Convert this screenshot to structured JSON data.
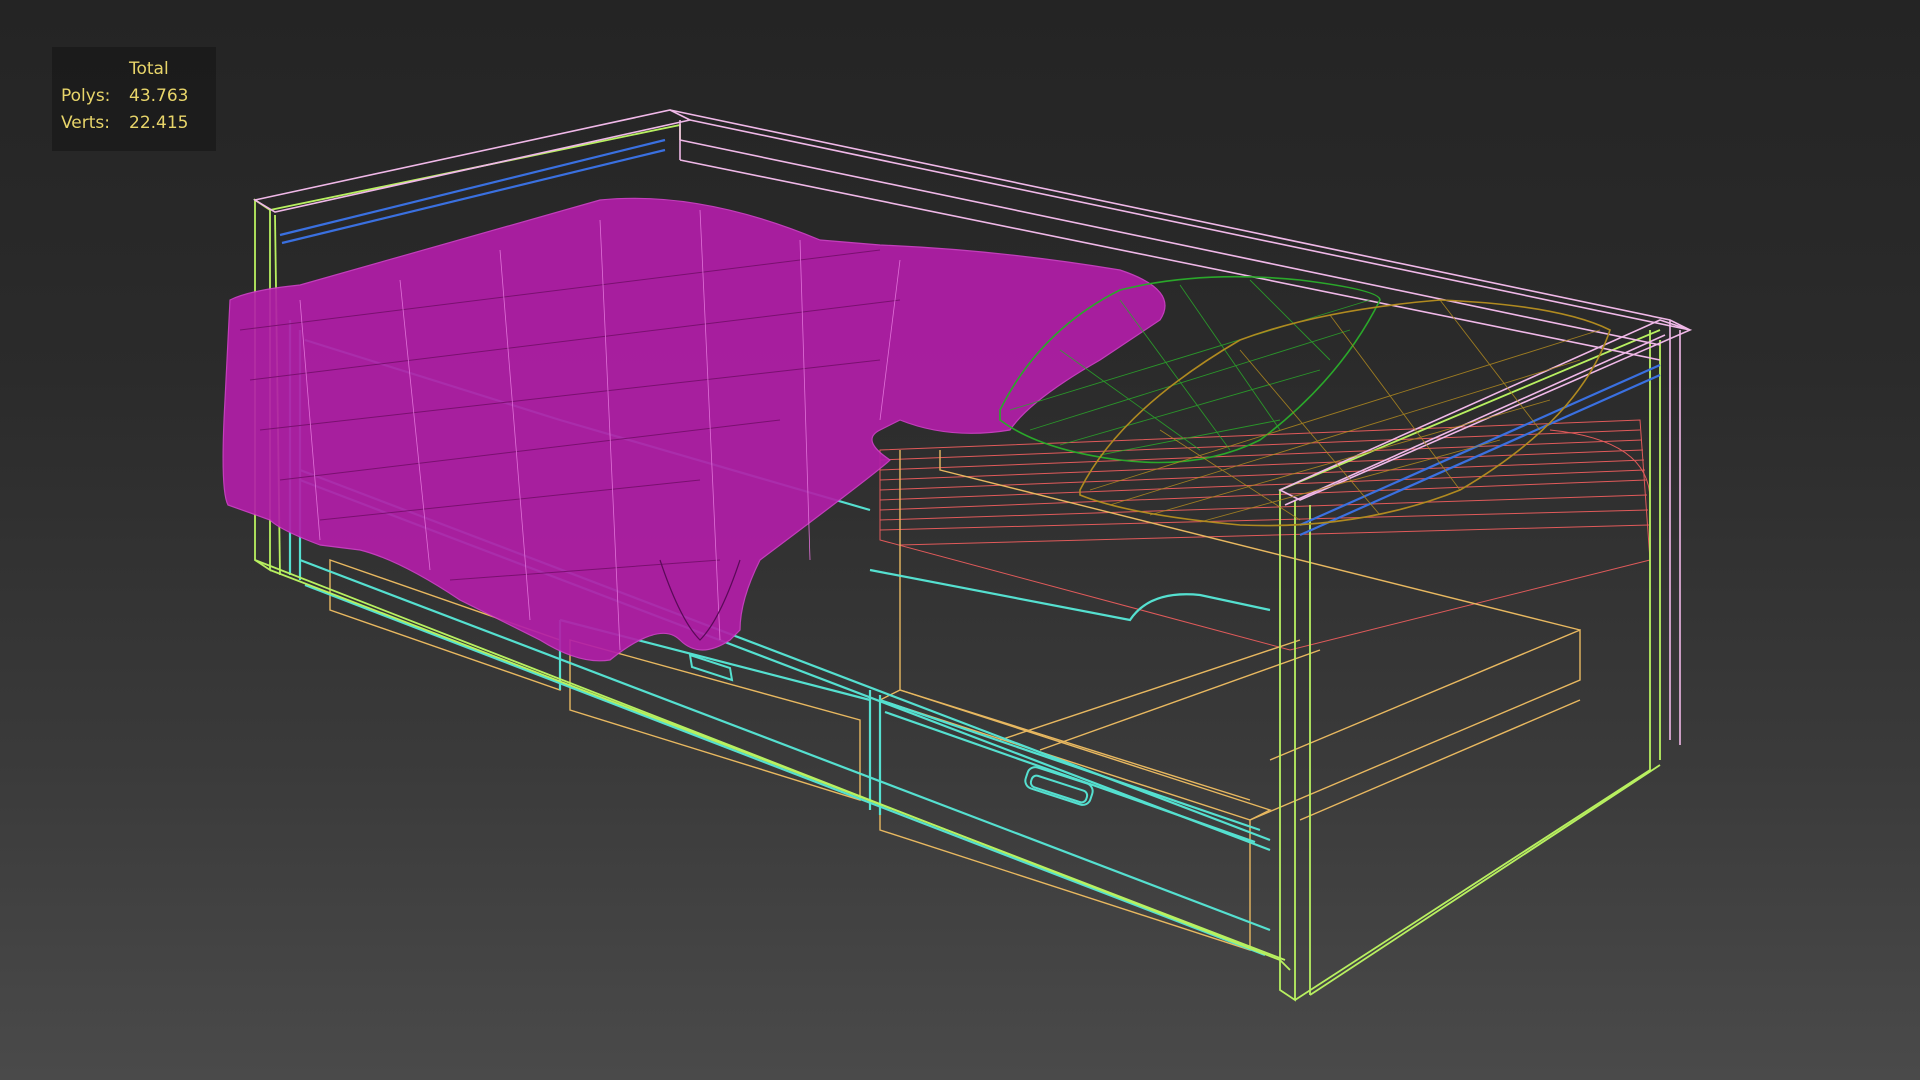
{
  "stats": {
    "header": "Total",
    "rows": [
      {
        "label": "Polys:",
        "value": "43.763"
      },
      {
        "label": "Verts:",
        "value": "22.415"
      }
    ]
  },
  "colors": {
    "blanket": "#c020b0",
    "pillow_green": "#2aa82a",
    "pillow_gold": "#b08a20",
    "frame_cyan": "#55e0d0",
    "frame_lime": "#b8f060",
    "frame_pink": "#f0b8e8",
    "drawer_orange": "#e8b860",
    "mattress_red": "#e05a5a",
    "rail_blue": "#3a70e0"
  },
  "viewport": {
    "mode": "wireframe",
    "object": "bed-model"
  }
}
